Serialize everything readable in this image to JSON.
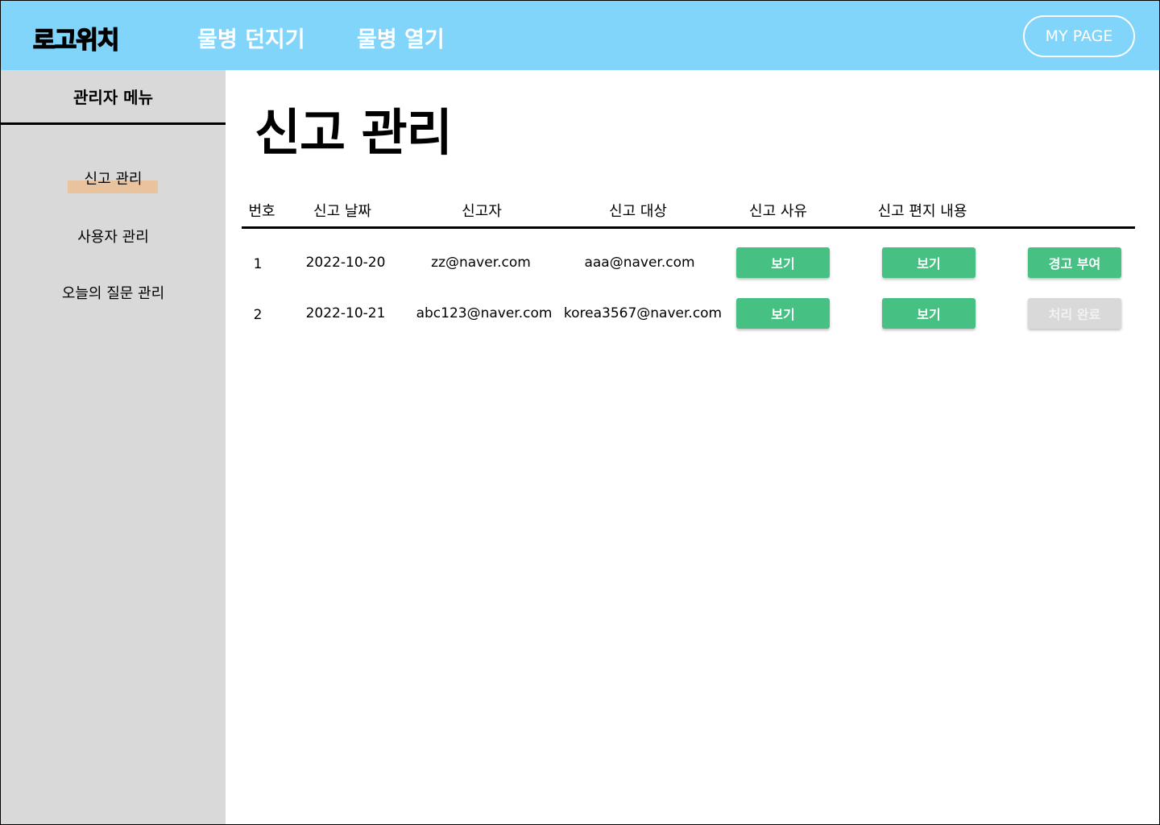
{
  "header": {
    "logo": "로고위치",
    "nav": [
      "물병 던지기",
      "물병 열기"
    ],
    "mypage_label": "MY PAGE",
    "color": "#81D4FA"
  },
  "sidebar": {
    "title": "관리자 메뉴",
    "items": [
      {
        "label": "신고 관리",
        "active": true
      },
      {
        "label": "사용자 관리",
        "active": false
      },
      {
        "label": "오늘의 질문 관리",
        "active": false
      }
    ],
    "background": "#D9D9D9",
    "active_marker_color": "#E8C39E"
  },
  "main": {
    "title": "신고 관리",
    "table": {
      "headers": [
        "번호",
        "신고 날짜",
        "신고자",
        "신고 대상",
        "신고 사유",
        "신고 편지 내용"
      ],
      "rows": [
        {
          "no": "1",
          "date": "2022-10-20",
          "reporter": "zz@naver.com",
          "target": "aaa@naver.com",
          "reason_btn": "보기",
          "letter_btn": "보기",
          "action_btn": "경고 부여",
          "action_state": "pending"
        },
        {
          "no": "2",
          "date": "2022-10-21",
          "reporter": "abc123@naver.com",
          "target": "korea3567@naver.com",
          "reason_btn": "보기",
          "letter_btn": "보기",
          "action_btn": "처리 완료",
          "action_state": "done"
        }
      ]
    },
    "button_colors": {
      "primary": "#47C083",
      "disabled": "#D9D9D9"
    }
  }
}
